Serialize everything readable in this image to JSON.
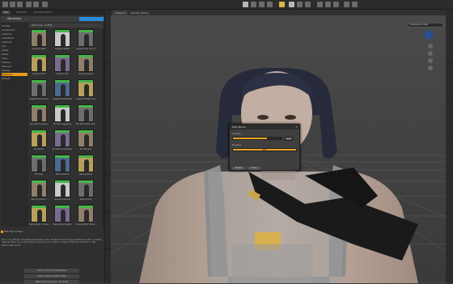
{
  "left_panel": {
    "tabs": [
      "Files",
      "Products",
      "Smart Content"
    ],
    "header_title": "Wardrobe",
    "category_header": "Wardrobe · Outfits",
    "categories": [
      {
        "label": "All Files"
      },
      {
        "label": "Accessories"
      },
      {
        "label": "Anatomy"
      },
      {
        "label": "Animations"
      },
      {
        "label": "Cameras"
      },
      {
        "label": "Hair"
      },
      {
        "label": "Lights"
      },
      {
        "label": "Poses"
      },
      {
        "label": "Props"
      },
      {
        "label": "Shaders"
      },
      {
        "label": "Wearing"
      },
      {
        "label": "Utilities"
      },
      {
        "label": "Wardrobe"
      },
      {
        "label": "Default"
      }
    ],
    "selected_category": 12,
    "items": [
      {
        "label": "Leopard Heel"
      },
      {
        "label": "Leopard Pants"
      },
      {
        "label": "Leopard Top Iron Cover"
      },
      {
        "label": "Leopard Skirt"
      },
      {
        "label": "Leopard Top"
      },
      {
        "label": "Leopard Jacket"
      },
      {
        "label": "Leopard Pants Glove"
      },
      {
        "label": "Leopard Pants Broken"
      },
      {
        "label": "Leopard Sleeve Cover"
      },
      {
        "label": "Pin Skirt by Jeans"
      },
      {
        "label": "Pin Skirt Leggings"
      },
      {
        "label": "Pin Skirt Outer Skin"
      },
      {
        "label": "Pin Boots"
      },
      {
        "label": "Pin Skirt Outerwear"
      },
      {
        "label": "Pin Top Suit"
      },
      {
        "label": "Pin Heel"
      },
      {
        "label": "Racing Boots"
      },
      {
        "label": "Racing Pants"
      },
      {
        "label": "Racing Glove L"
      },
      {
        "label": "Racing Glove R"
      },
      {
        "label": "Racing Suit"
      },
      {
        "label": "Racing Suit L Glove"
      },
      {
        "label": "Racing Suit Jacket"
      },
      {
        "label": "Racing SUIT Glove"
      }
    ],
    "filter_label": "Filter By Context",
    "description": "Tip 5 - By default, everything displayed in the \"Smart Content\" pane is filtered by the currently selected item. If you would like to see all your content, uncheck \"Filter By Context\" in the bottom left corner.",
    "buttons": [
      "Click on icons to load items",
      "Select Smart Content Filter",
      "Filter Smart Content • Products"
    ]
  },
  "viewport": {
    "tabs": [
      "Viewport",
      "Render Library"
    ],
    "camera": "Perspective View"
  },
  "dialog": {
    "title": "DAZ Studio",
    "label1": "Loading...",
    "progress1": 0.7,
    "cancel_label": "Abort",
    "label2": "Progress",
    "progress2": 1.0,
    "progress2_text": "99%",
    "btn_left": "Restart",
    "btn_right": "Close"
  }
}
